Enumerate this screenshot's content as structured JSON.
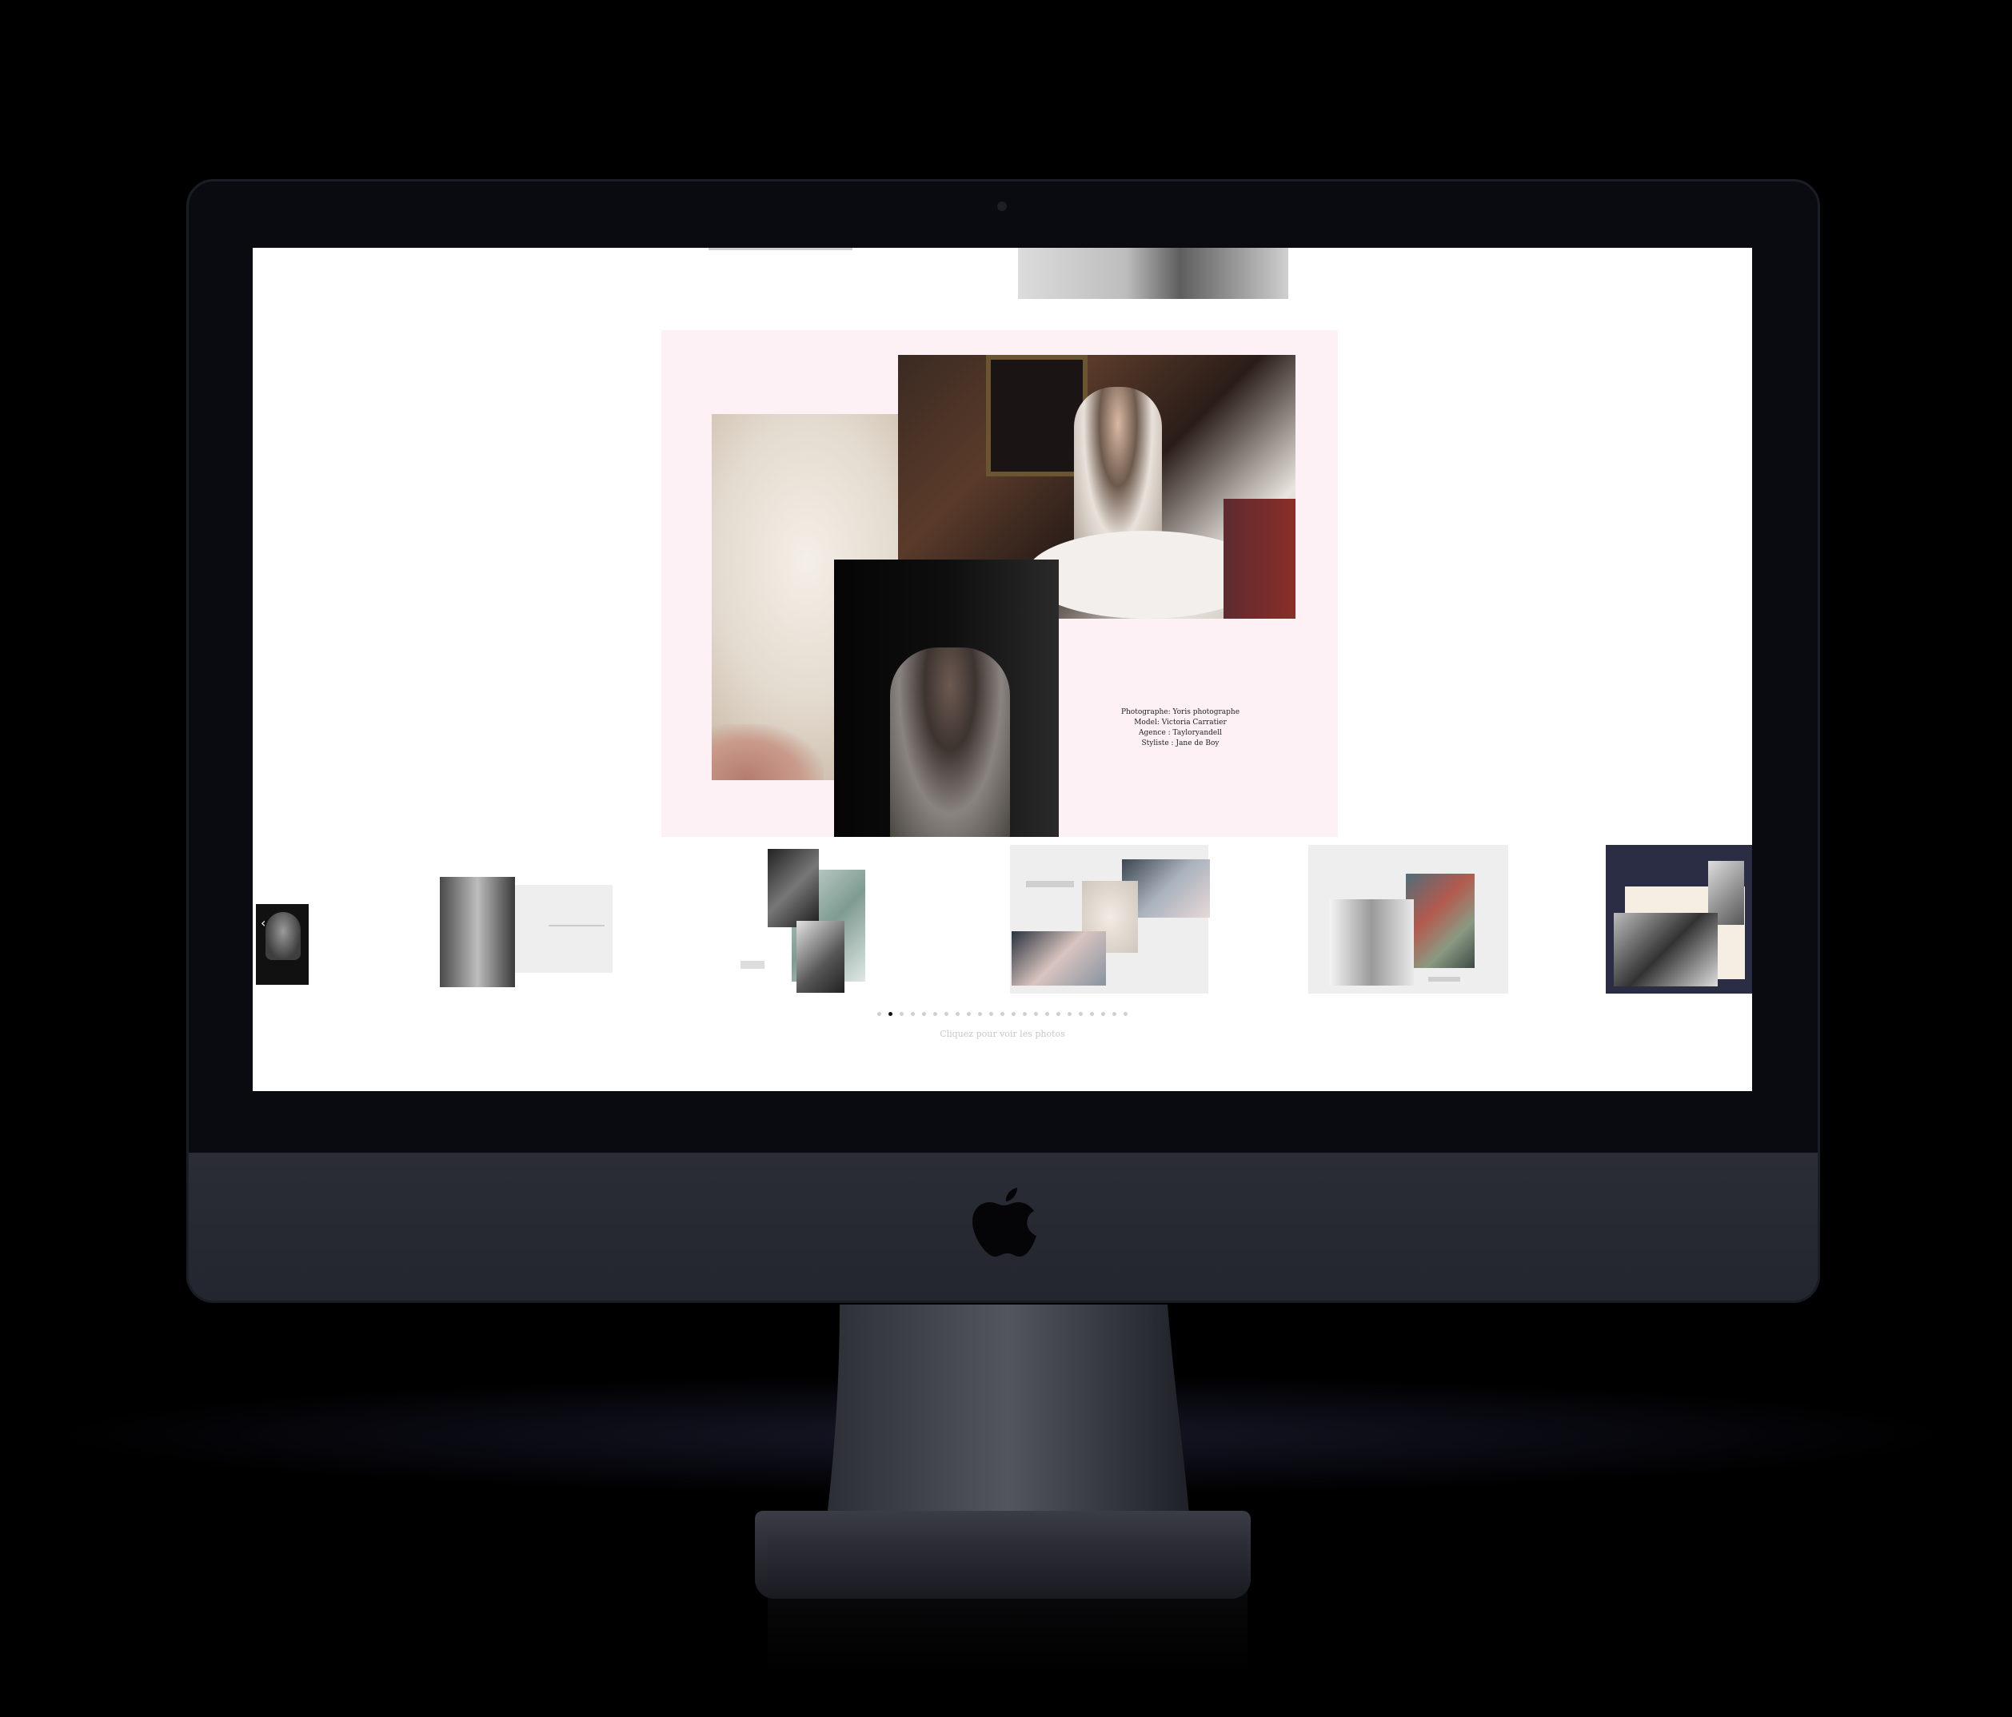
{
  "gallery": {
    "credits": {
      "photographer": "Photographe: Yoris photographe",
      "model": "Model: Victoria Carratier",
      "agency": "Agence : Tayloryandell",
      "stylist": "Styliste : Jane de Boy"
    },
    "pagination": {
      "total": 23,
      "active_index": 1
    },
    "hint": "Cliquez pour voir les photos"
  },
  "colors": {
    "card_background": "#fdf1f6",
    "screen_background": "#ffffff",
    "frame": "#0a0b10",
    "navy_thumb": "#2b2d45"
  },
  "icons": {
    "prev": "chevron-left-icon",
    "brand": "apple-logo-icon"
  }
}
